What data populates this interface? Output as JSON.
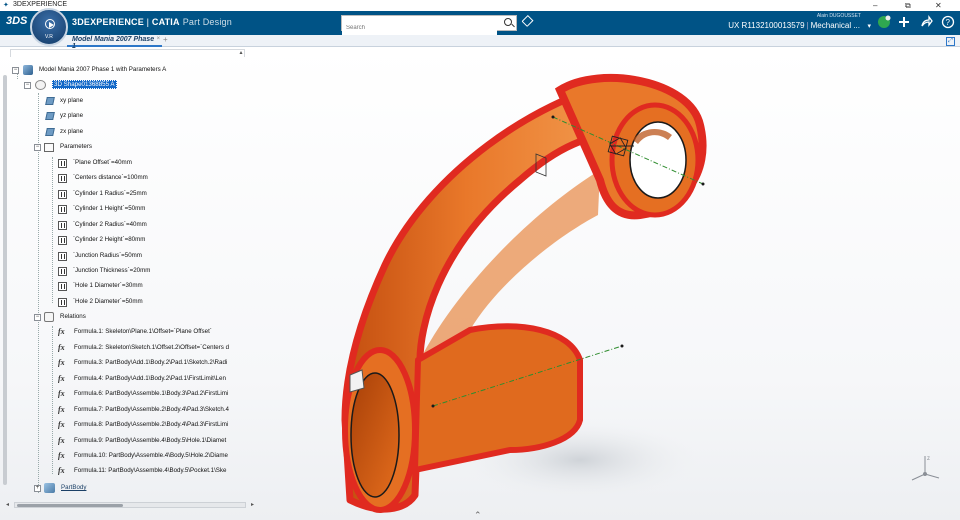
{
  "window": {
    "title": "3DEXPERIENCE",
    "min": "–",
    "max": "⧉",
    "close": "✕"
  },
  "topbar": {
    "brand_main": "3DEXPERIENCE",
    "brand_sep": " | ",
    "brand_app": "CATIA",
    "brand_role": "Part Design",
    "compass_label": "V.R",
    "search_placeholder": "Search",
    "user_name": "Alain DUGOUSSET",
    "context_id": "UX R1132100013579",
    "context_sep": "|",
    "context_role": "Mechanical ...",
    "chev": "▾"
  },
  "tabs": [
    {
      "label": "Model Mania 2007 Phase 1",
      "close": "×"
    }
  ],
  "tab_add": "+",
  "tree": {
    "root": "Model Mania 2007 Phase 1 with Parameters A",
    "shape": "3D Shape01368855 A",
    "planes": [
      "xy plane",
      "yz plane",
      "zx plane"
    ],
    "parameters_label": "Parameters",
    "parameters": [
      "`Plane Offset`=40mm",
      "`Centers distance`=100mm",
      "`Cylinder 1 Radius`=25mm",
      "`Cylinder 1 Height`=50mm",
      "`Cylinder 2 Radius`=40mm",
      "`Cylinder 2 Height`=80mm",
      "`Junction Radius`=50mm",
      "`Junction Thickness`=20mm",
      "`Hole 1 Diameter`=30mm",
      "`Hole 2 Diameter`=50mm"
    ],
    "relations_label": "Relations",
    "formula_glyph": "fx",
    "formulas": [
      "Formula.1: Skeleton\\Plane.1\\Offset=`Plane Offset`",
      "Formula.2: Skeleton\\Sketch.1\\Offset.2\\Offset=`Centers d",
      "Formula.3: PartBody\\Add.1\\Body.2\\Pad.1\\Sketch.2\\Radi",
      "Formula.4: PartBody\\Add.1\\Body.2\\Pad.1\\FirstLimit\\Len",
      "Formula.6: PartBody\\Assemble.1\\Body.3\\Pad.2\\FirstLimi",
      "Formula.7: PartBody\\Assemble.2\\Body.4\\Pad.3\\Sketch.4",
      "Formula.8: PartBody\\Assemble.2\\Body.4\\Pad.3\\FirstLimi",
      "Formula.9: PartBody\\Assemble.4\\Body.5\\Hole.1\\Diamet",
      "Formula.10: PartBody\\Assemble.4\\Body.5\\Hole.2\\Diame",
      "Formula.11: PartBody\\Assemble.4\\Body.5\\Pocket.1\\Ske"
    ],
    "partbody": "PartBody",
    "expander_minus": "−",
    "expander_plus": "+"
  },
  "scroll": {
    "left": "◂",
    "right": "▸",
    "up": "▴"
  },
  "viewport": {
    "caret": "⌃",
    "compass_axis": "z"
  },
  "colors": {
    "topbar": "#005386",
    "part_orange": "#e06a1e",
    "part_red": "#e02a20",
    "selection": "#1167c7",
    "axis_green": "#3aa83a"
  }
}
